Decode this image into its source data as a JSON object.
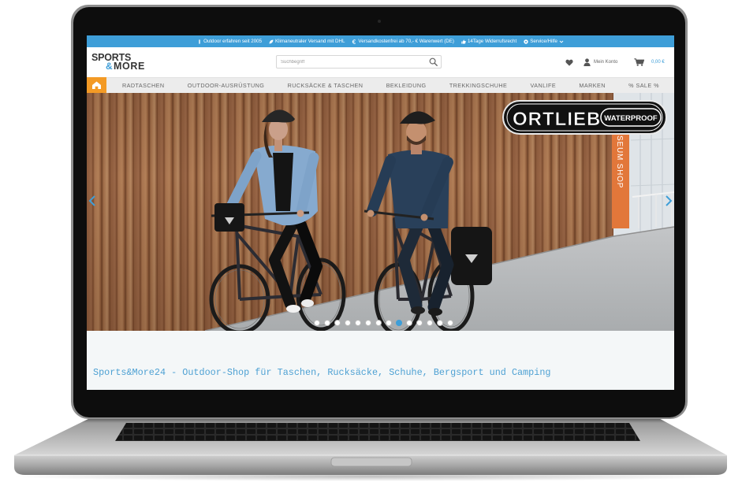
{
  "topbar": {
    "background": "#3e9ed8",
    "items": [
      {
        "icon": "info-icon",
        "label": "Outdoor erfahren seit 2005"
      },
      {
        "icon": "leaf-icon",
        "label": "Klimaneutraler Versand mit DHL"
      },
      {
        "icon": "euro-icon",
        "label": "Versandkostenfrei ab 70,- € Warenwert (DE)"
      },
      {
        "icon": "thumbs-up-icon",
        "label": "14Tage Widerrufsrecht"
      },
      {
        "icon": "help-icon",
        "label": "Service/Hilfe"
      }
    ]
  },
  "header": {
    "logo": {
      "line1": "SPORTS",
      "amp": "&",
      "line2": "MORE"
    },
    "search": {
      "placeholder": "Suchbegriff",
      "value": ""
    },
    "account_label": "Mein Konto",
    "cart_total": "0,00 €",
    "accent": "#3e9ed8"
  },
  "nav": {
    "home_color": "#f39a25",
    "items": [
      "RADTASCHEN",
      "OUTDOOR-AUSRÜSTUNG",
      "RUCKSÄCKE & TASCHEN",
      "BEKLEIDUNG",
      "TREKKINGSCHUHE",
      "VANLIFE",
      "MARKEN",
      "% SALE %"
    ]
  },
  "hero": {
    "brand": "ORTLIEB",
    "brand_badge": "WATERPROOF",
    "sign_text": "SEUM SHOP",
    "carousel": {
      "slide_count": 14,
      "active_index": 8
    }
  },
  "tagline": {
    "text": "Sports&More24 - Outdoor-Shop für Taschen, Rucksäcke, Schuhe, Bergsport und Camping",
    "color": "#4ea1d3"
  }
}
